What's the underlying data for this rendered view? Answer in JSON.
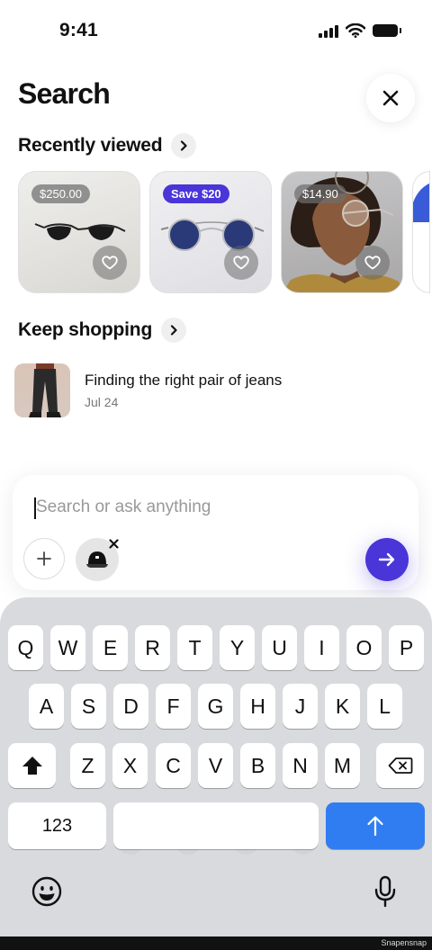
{
  "status": {
    "time": "9:41"
  },
  "header": {
    "title": "Search"
  },
  "recently_viewed": {
    "label": "Recently viewed",
    "items": [
      {
        "badge": "$250.00",
        "badge_type": "price",
        "product": "black-sunglasses"
      },
      {
        "badge": "Save $20",
        "badge_type": "save",
        "product": "blue-round-sunglasses"
      },
      {
        "badge": "$14.90",
        "badge_type": "price",
        "product": "model-with-glasses"
      }
    ]
  },
  "keep_shopping": {
    "label": "Keep shopping",
    "items": [
      {
        "title": "Finding the right pair of jeans",
        "date": "Jul 24"
      }
    ]
  },
  "search": {
    "placeholder": "Search or ask anything",
    "value": "",
    "attachment": "cap-icon"
  },
  "keyboard": {
    "row1": [
      "Q",
      "W",
      "E",
      "R",
      "T",
      "Y",
      "U",
      "I",
      "O",
      "P"
    ],
    "row2": [
      "A",
      "S",
      "D",
      "F",
      "G",
      "H",
      "J",
      "K",
      "L"
    ],
    "row3": [
      "Z",
      "X",
      "C",
      "V",
      "B",
      "N",
      "M"
    ],
    "numbers_key": "123"
  },
  "colors": {
    "accent": "#4A35D8",
    "keyboard_return": "#2F7DF1",
    "keyboard_bg": "#D9DADE"
  },
  "footer": {
    "watermark": "Snapensnap"
  }
}
